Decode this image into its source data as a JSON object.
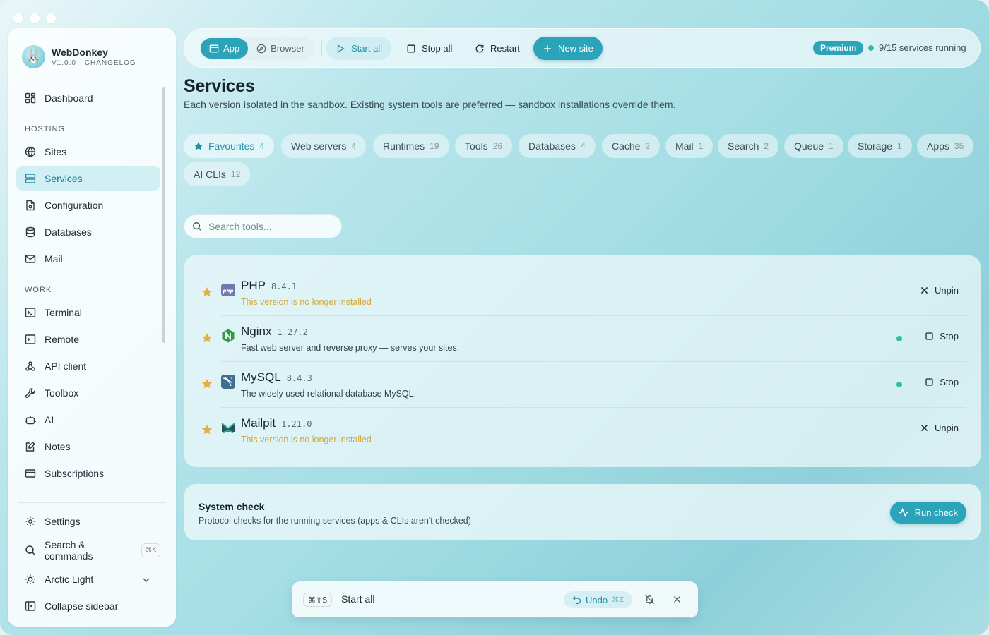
{
  "app": {
    "name": "WebDonkey",
    "version": "V1.0.0 · CHANGELOG"
  },
  "sidebar": {
    "items_top": [
      {
        "label": "Dashboard",
        "icon": "dashboard-icon"
      }
    ],
    "section_hosting": "HOSTING",
    "hosting": [
      {
        "label": "Sites",
        "icon": "globe-icon"
      },
      {
        "label": "Services",
        "icon": "server-icon",
        "active": true
      },
      {
        "label": "Configuration",
        "icon": "config-file-icon"
      },
      {
        "label": "Databases",
        "icon": "database-icon"
      },
      {
        "label": "Mail",
        "icon": "mail-icon"
      }
    ],
    "section_work": "WORK",
    "work": [
      {
        "label": "Terminal",
        "icon": "terminal-icon"
      },
      {
        "label": "Remote",
        "icon": "remote-terminal-icon"
      },
      {
        "label": "API client",
        "icon": "api-icon"
      },
      {
        "label": "Toolbox",
        "icon": "wrench-icon"
      },
      {
        "label": "AI",
        "icon": "robot-icon"
      },
      {
        "label": "Notes",
        "icon": "notes-icon"
      },
      {
        "label": "Subscriptions",
        "icon": "card-icon"
      }
    ],
    "bottom": {
      "settings": "Settings",
      "search": "Search & commands",
      "search_kbd": "⌘K",
      "theme": "Arctic Light",
      "collapse": "Collapse sidebar"
    }
  },
  "topbar": {
    "app": "App",
    "browser": "Browser",
    "start_all": "Start all",
    "stop_all": "Stop all",
    "restart": "Restart",
    "new_site": "New site",
    "premium": "Premium",
    "running": "9/15 services running"
  },
  "page": {
    "title": "Services",
    "description": "Each version isolated in the sandbox. Existing system tools are preferred — sandbox installations override them."
  },
  "tabs": [
    {
      "label": "Favourites",
      "count": "4",
      "active": true
    },
    {
      "label": "Web servers",
      "count": "4"
    },
    {
      "label": "Runtimes",
      "count": "19"
    },
    {
      "label": "Tools",
      "count": "26"
    },
    {
      "label": "Databases",
      "count": "4"
    },
    {
      "label": "Cache",
      "count": "2"
    },
    {
      "label": "Mail",
      "count": "1"
    },
    {
      "label": "Search",
      "count": "2"
    },
    {
      "label": "Queue",
      "count": "1"
    },
    {
      "label": "Storage",
      "count": "1"
    },
    {
      "label": "Apps",
      "count": "35"
    },
    {
      "label": "AI CLIs",
      "count": "12"
    }
  ],
  "search": {
    "placeholder": "Search tools..."
  },
  "services": [
    {
      "name": "PHP",
      "version": "8.4.1",
      "description": "This version is no longer installed",
      "warn": true,
      "action": "Unpin",
      "running": false,
      "logo": "php-logo-icon"
    },
    {
      "name": "Nginx",
      "version": "1.27.2",
      "description": "Fast web server and reverse proxy — serves your sites.",
      "warn": false,
      "action": "Stop",
      "running": true,
      "logo": "nginx-logo-icon"
    },
    {
      "name": "MySQL",
      "version": "8.4.3",
      "description": "The widely used relational database MySQL.",
      "warn": false,
      "action": "Stop",
      "running": true,
      "logo": "mysql-logo-icon"
    },
    {
      "name": "Mailpit",
      "version": "1.21.0",
      "description": "This version is no longer installed",
      "warn": true,
      "action": "Unpin",
      "running": false,
      "logo": "mailpit-logo-icon"
    }
  ],
  "system_check": {
    "title": "System check",
    "description": "Protocol checks for the running services (apps & CLIs aren't checked)",
    "button": "Run check"
  },
  "toast": {
    "kbd": "⌘⇧S",
    "text": "Start all",
    "undo": "Undo",
    "undo_kbd": "⌘Z"
  },
  "colors": {
    "accent": "#2ba3b9",
    "running": "#2ec295",
    "warning": "#d4a73f",
    "star": "#e2b042"
  }
}
